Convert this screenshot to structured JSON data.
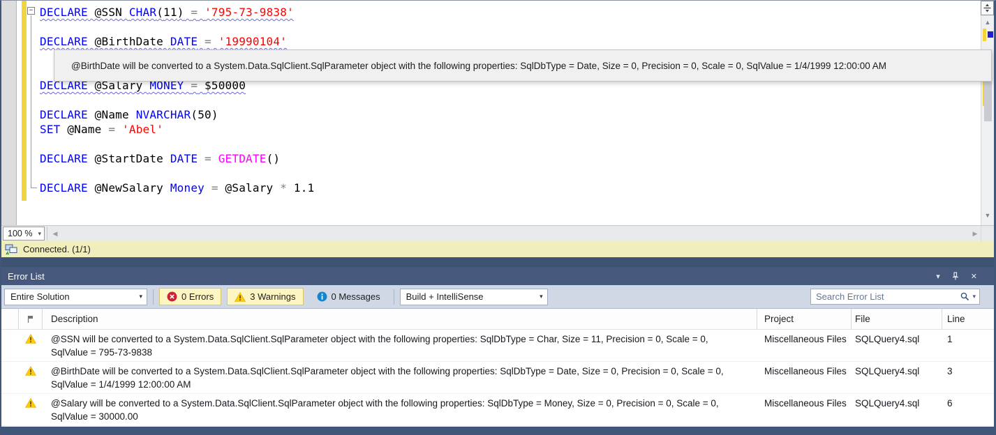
{
  "colors": {
    "keyword": "#0000ff",
    "string": "#ff0000",
    "builtin": "#ff00ff",
    "operator": "#808080",
    "squiggle": "#6a6ad8",
    "track_change": "#f2d53d",
    "gutter": "#dcdddf",
    "statusbar": "#f1eebd",
    "panel_title": "#46597c",
    "panel_sep": "#3e5271",
    "toolbar": "#d0d7e5",
    "filter_bg": "#fdf5c2",
    "filter_border": "#dcc568",
    "warning": "#ffcc00",
    "error": "#cf2233",
    "info": "#0f86d2",
    "caret_mark": "#2222cc",
    "window_border": "#41577a"
  },
  "icons": {
    "chevron_down": "▾",
    "close": "✕",
    "up_arrow": "▲",
    "down_arrow": "▼",
    "left_arrow": "◀",
    "right_arrow": "▶",
    "fold_collapse": "−"
  },
  "editor": {
    "tooltip": "@BirthDate will be converted to a System.Data.SqlClient.SqlParameter object with the following properties: SqlDbType = Date, Size = 0, Precision = 0, Scale = 0, SqlValue = 1/4/1999 12:00:00 AM",
    "zoom_level": "100 %",
    "status_text": "Connected. (1/1)",
    "code": {
      "lines": [
        {
          "squiggle": true,
          "tokens": [
            {
              "c": "kw",
              "t": "DECLARE"
            },
            {
              "c": "id",
              "t": " @SSN "
            },
            {
              "c": "kw",
              "t": "CHAR"
            },
            {
              "c": "pn",
              "t": "("
            },
            {
              "c": "num",
              "t": "11"
            },
            {
              "c": "pn",
              "t": ")"
            },
            {
              "c": "id",
              "t": " "
            },
            {
              "c": "op",
              "t": "="
            },
            {
              "c": "id",
              "t": " "
            },
            {
              "c": "str",
              "t": "'795-73-9838'"
            }
          ]
        },
        {
          "tokens": []
        },
        {
          "squiggle": true,
          "tokens": [
            {
              "c": "kw",
              "t": "DECLARE"
            },
            {
              "c": "id",
              "t": " @BirthDate "
            },
            {
              "c": "kw",
              "t": "DATE"
            },
            {
              "c": "id",
              "t": " "
            },
            {
              "c": "op",
              "t": "="
            },
            {
              "c": "id",
              "t": " "
            },
            {
              "c": "str",
              "t": "'19990104'"
            }
          ]
        },
        {
          "tokens": []
        },
        {
          "tokens": []
        },
        {
          "squiggle": true,
          "tokens": [
            {
              "c": "kw",
              "t": "DECLARE"
            },
            {
              "c": "id",
              "t": " @Salary "
            },
            {
              "c": "kw",
              "t": "MONEY"
            },
            {
              "c": "id",
              "t": " "
            },
            {
              "c": "op",
              "t": "="
            },
            {
              "c": "id",
              "t": " "
            },
            {
              "c": "num",
              "t": "$50000"
            }
          ]
        },
        {
          "tokens": []
        },
        {
          "tokens": [
            {
              "c": "kw",
              "t": "DECLARE"
            },
            {
              "c": "id",
              "t": " @Name "
            },
            {
              "c": "kw",
              "t": "NVARCHAR"
            },
            {
              "c": "pn",
              "t": "("
            },
            {
              "c": "num",
              "t": "50"
            },
            {
              "c": "pn",
              "t": ")"
            }
          ]
        },
        {
          "tokens": [
            {
              "c": "kw",
              "t": "SET"
            },
            {
              "c": "id",
              "t": " @Name "
            },
            {
              "c": "op",
              "t": "="
            },
            {
              "c": "id",
              "t": " "
            },
            {
              "c": "str",
              "t": "'Abel'"
            }
          ]
        },
        {
          "tokens": []
        },
        {
          "tokens": [
            {
              "c": "kw",
              "t": "DECLARE"
            },
            {
              "c": "id",
              "t": " @StartDate "
            },
            {
              "c": "kw",
              "t": "DATE"
            },
            {
              "c": "id",
              "t": " "
            },
            {
              "c": "op",
              "t": "="
            },
            {
              "c": "id",
              "t": " "
            },
            {
              "c": "fn",
              "t": "GETDATE"
            },
            {
              "c": "pn",
              "t": "()"
            }
          ]
        },
        {
          "tokens": []
        },
        {
          "tokens": [
            {
              "c": "kw",
              "t": "DECLARE"
            },
            {
              "c": "id",
              "t": " @NewSalary "
            },
            {
              "c": "kw",
              "t": "Money"
            },
            {
              "c": "id",
              "t": " "
            },
            {
              "c": "op",
              "t": "="
            },
            {
              "c": "id",
              "t": " @Salary "
            },
            {
              "c": "op",
              "t": "*"
            },
            {
              "c": "num",
              "t": " 1.1"
            }
          ]
        }
      ]
    }
  },
  "error_list": {
    "title": "Error List",
    "toolbar": {
      "scope": "Entire Solution",
      "errors_label": "0 Errors",
      "warnings_label": "3 Warnings",
      "messages_label": "0 Messages",
      "source": "Build + IntelliSense",
      "search_placeholder": "Search Error List"
    },
    "columns": {
      "description": "Description",
      "project": "Project",
      "file": "File",
      "line": "Line"
    },
    "rows": [
      {
        "severity": "warning",
        "description": "@SSN will be converted to a System.Data.SqlClient.SqlParameter object with the following properties: SqlDbType = Char, Size = 11, Precision = 0, Scale = 0, SqlValue = 795-73-9838",
        "project": "Miscellaneous Files",
        "file": "SQLQuery4.sql",
        "line": "1"
      },
      {
        "severity": "warning",
        "description": "@BirthDate will be converted to a System.Data.SqlClient.SqlParameter object with the following properties: SqlDbType = Date, Size = 0, Precision = 0, Scale = 0, SqlValue = 1/4/1999 12:00:00 AM",
        "project": "Miscellaneous Files",
        "file": "SQLQuery4.sql",
        "line": "3"
      },
      {
        "severity": "warning",
        "description": "@Salary will be converted to a System.Data.SqlClient.SqlParameter object with the following properties: SqlDbType = Money, Size = 0, Precision = 0, Scale = 0, SqlValue = 30000.00",
        "project": "Miscellaneous Files",
        "file": "SQLQuery4.sql",
        "line": "6"
      }
    ]
  }
}
